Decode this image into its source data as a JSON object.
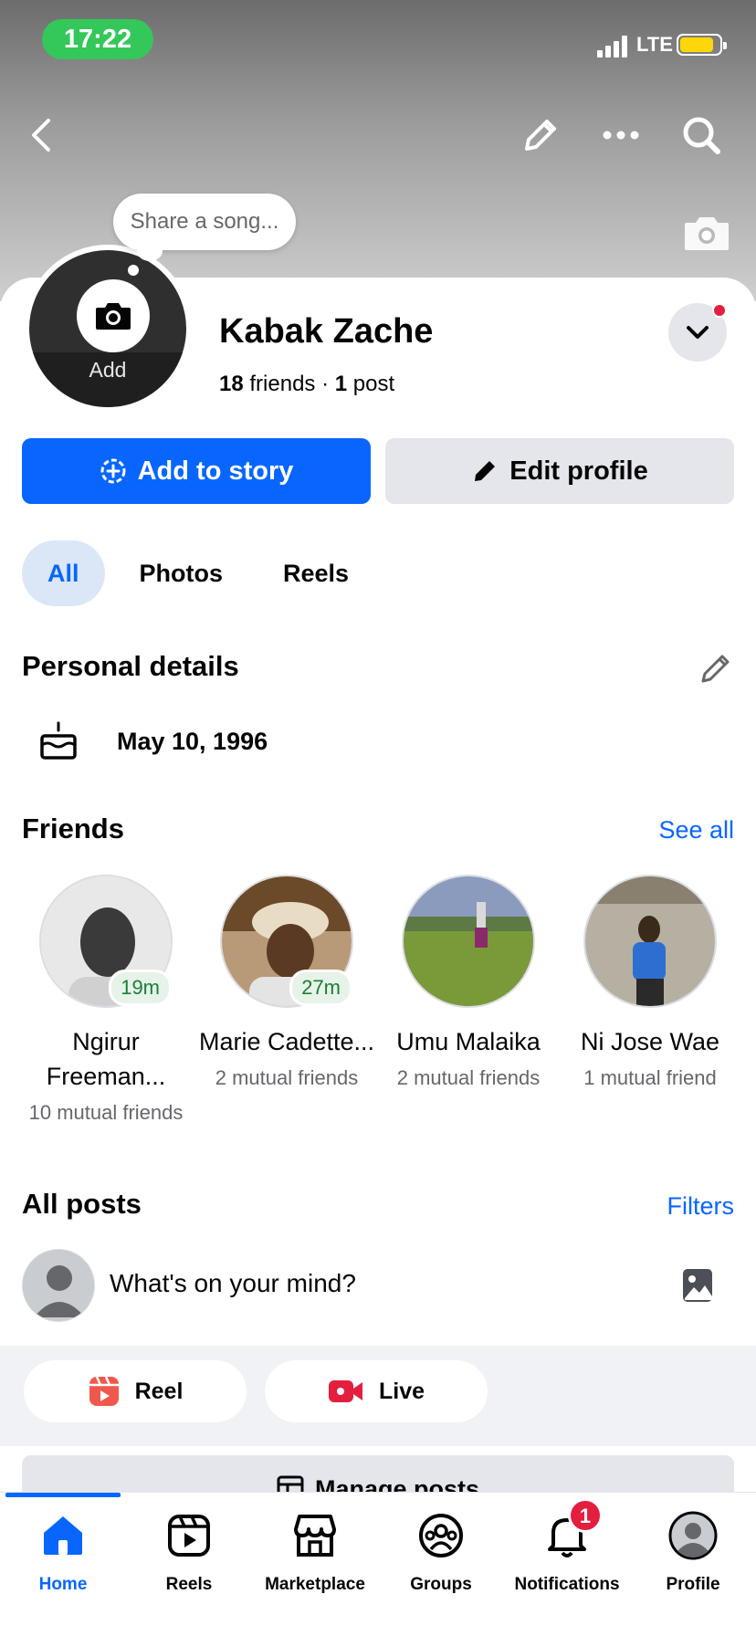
{
  "status_bar": {
    "time": "17:22",
    "network": "LTE"
  },
  "profile": {
    "song_prompt": "Share a song...",
    "avatar_action": "Add",
    "name": "Kabak Zache",
    "friends_count": "18",
    "friends_word": "friends",
    "separator": "·",
    "posts_count": "1",
    "posts_word": "post"
  },
  "buttons": {
    "add_to_story": "Add to story",
    "edit_profile": "Edit profile"
  },
  "tabs": [
    {
      "label": "All"
    },
    {
      "label": "Photos"
    },
    {
      "label": "Reels"
    }
  ],
  "personal_details": {
    "title": "Personal details",
    "birthday": "May 10, 1996"
  },
  "friends_section": {
    "title": "Friends",
    "see_all": "See all",
    "items": [
      {
        "name": "Ngirur Freeman...",
        "mutual": "10 mutual friends",
        "badge": "19m"
      },
      {
        "name": "Marie Cadette...",
        "mutual": "2 mutual friends",
        "badge": "27m"
      },
      {
        "name": "Umu Malaika",
        "mutual": "2 mutual friends",
        "badge": ""
      },
      {
        "name": "Ni Jose Wae",
        "mutual": "1 mutual friend",
        "badge": ""
      }
    ]
  },
  "posts": {
    "title": "All posts",
    "filters": "Filters",
    "composer_prompt": "What's on your mind?",
    "reel_label": "Reel",
    "live_label": "Live",
    "manage_posts": "Manage posts"
  },
  "bottom_nav": [
    {
      "label": "Home",
      "icon": "home-icon"
    },
    {
      "label": "Reels",
      "icon": "reels-icon"
    },
    {
      "label": "Marketplace",
      "icon": "marketplace-icon"
    },
    {
      "label": "Groups",
      "icon": "groups-icon"
    },
    {
      "label": "Notifications",
      "icon": "bell-icon",
      "badge": "1"
    },
    {
      "label": "Profile",
      "icon": "profile-icon"
    }
  ],
  "colors": {
    "accent": "#0866ff",
    "badge_red": "#e41e3f",
    "status_green": "#34c759"
  }
}
